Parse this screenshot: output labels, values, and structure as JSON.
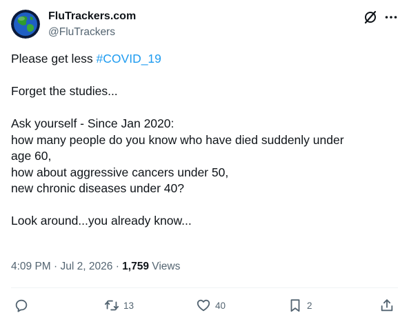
{
  "author": {
    "name": "FluTrackers.com",
    "handle": "@FluTrackers",
    "avatar": "globe-avatar"
  },
  "tweet": {
    "line1_prefix": "Please get less ",
    "hashtag": "#COVID_19",
    "line2": "Forget the studies...",
    "line3": "Ask yourself - Since Jan 2020:",
    "line4": "how many people do you know who have died suddenly under",
    "line5": "age 60,",
    "line6": "how about aggressive cancers under 50,",
    "line7": "new chronic diseases under 40?",
    "line8": "Look around...you already know..."
  },
  "meta": {
    "time": "4:09 PM",
    "separator": "·",
    "date": "Jul 2, 2026",
    "views_count": "1,759",
    "views_label": "Views"
  },
  "actions": {
    "reply": {
      "icon": "reply-icon",
      "count": ""
    },
    "retweet": {
      "icon": "retweet-icon",
      "count": "13"
    },
    "like": {
      "icon": "heart-icon",
      "count": "40"
    },
    "bookmark": {
      "icon": "bookmark-icon",
      "count": "2"
    },
    "share": {
      "icon": "share-icon",
      "count": ""
    }
  },
  "colors": {
    "text": "#0f1419",
    "secondary": "#536471",
    "link": "#1d9bf0",
    "divider": "#eff3f4"
  }
}
